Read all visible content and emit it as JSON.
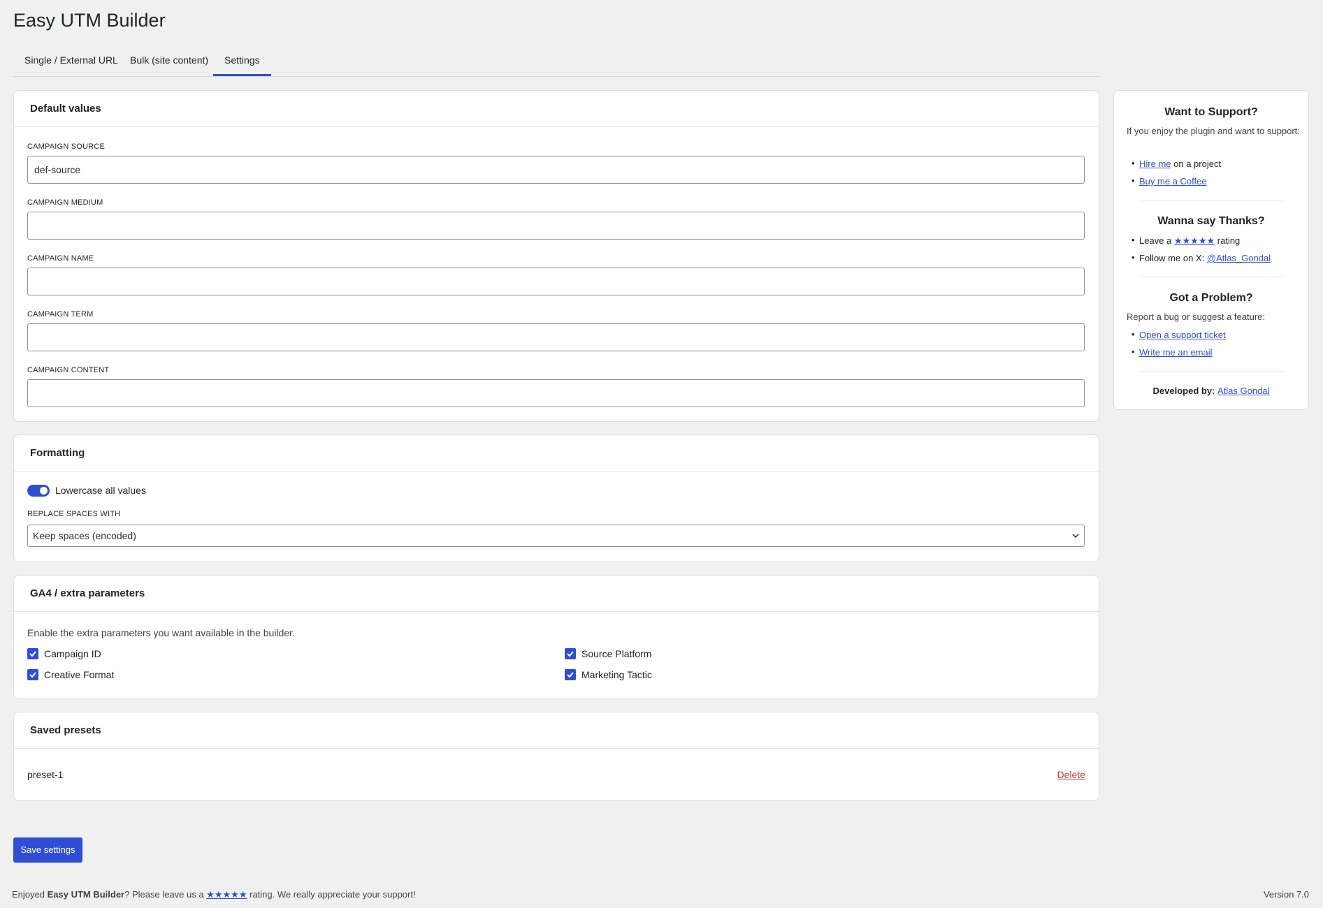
{
  "app": {
    "title": "Easy UTM Builder"
  },
  "tabs": [
    {
      "label": "Single / External URL"
    },
    {
      "label": "Bulk (site content)"
    },
    {
      "label": "Settings"
    }
  ],
  "defaults": {
    "heading": "Default values",
    "fields": [
      {
        "label": "CAMPAIGN SOURCE",
        "value": "def-source"
      },
      {
        "label": "CAMPAIGN MEDIUM",
        "value": ""
      },
      {
        "label": "CAMPAIGN NAME",
        "value": ""
      },
      {
        "label": "CAMPAIGN TERM",
        "value": ""
      },
      {
        "label": "CAMPAIGN CONTENT",
        "value": ""
      }
    ]
  },
  "formatting": {
    "heading": "Formatting",
    "lowercase_label": "Lowercase all values",
    "lowercase_on": true,
    "replace_label": "REPLACE SPACES WITH",
    "replace_value": "Keep spaces (encoded)"
  },
  "ga4": {
    "heading": "GA4 / extra parameters",
    "description": "Enable the extra parameters you want available in the builder.",
    "params": [
      {
        "label": "Campaign ID",
        "checked": true
      },
      {
        "label": "Source Platform",
        "checked": true
      },
      {
        "label": "Creative Format",
        "checked": true
      },
      {
        "label": "Marketing Tactic",
        "checked": true
      }
    ]
  },
  "presets": {
    "heading": "Saved presets",
    "items": [
      {
        "name": "preset-1",
        "delete_label": "Delete"
      }
    ]
  },
  "save_label": "Save settings",
  "footer": {
    "prefix": "Enjoyed ",
    "plugin_name": "Easy UTM Builder",
    "middle": "? Please leave us a ",
    "stars": "★★★★★",
    "suffix": " rating. We really appreciate your support!",
    "version": "Version 7.0"
  },
  "sidebar": {
    "support_title": "Want to Support?",
    "support_text": "If you enjoy the plugin and want to support:",
    "hire_link": "Hire me",
    "hire_suffix": " on a project",
    "coffee_link": "Buy me a Coffee",
    "thanks_title": "Wanna say Thanks?",
    "leave_prefix": "Leave a ",
    "leave_stars": "★★★★★",
    "leave_suffix": " rating",
    "follow_prefix": "Follow me on X: ",
    "follow_link": "@Atlas_Gondal",
    "problem_title": "Got a Problem?",
    "problem_text": "Report a bug or suggest a feature:",
    "ticket_link": "Open a support ticket",
    "email_link": "Write me an email",
    "dev_prefix": "Developed by: ",
    "dev_link": "Atlas Gondal"
  },
  "colors": {
    "accent": "#2e4ed6",
    "danger": "#d63638",
    "background": "#f0f0f1"
  }
}
